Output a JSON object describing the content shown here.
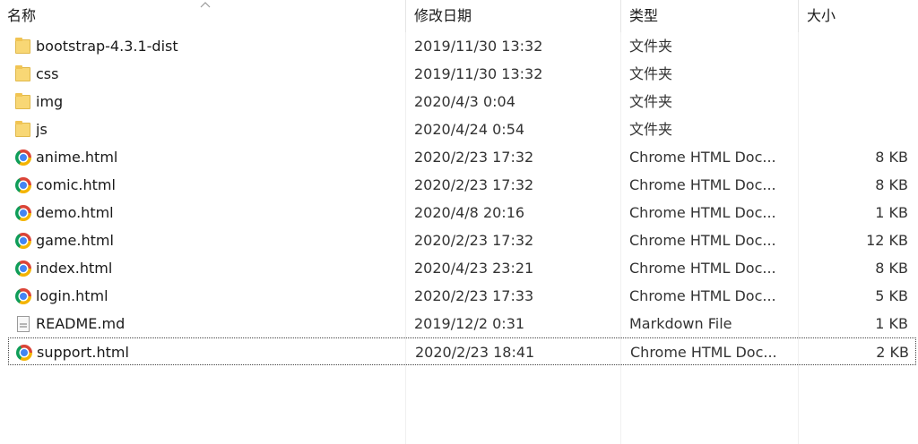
{
  "header": {
    "name": "名称",
    "date": "修改日期",
    "type": "类型",
    "size": "大小"
  },
  "files": [
    {
      "name": "bootstrap-4.3.1-dist",
      "date": "2019/11/30 13:32",
      "type": "文件夹",
      "size": "",
      "icon": "folder-icon"
    },
    {
      "name": "css",
      "date": "2019/11/30 13:32",
      "type": "文件夹",
      "size": "",
      "icon": "folder-icon"
    },
    {
      "name": "img",
      "date": "2020/4/3 0:04",
      "type": "文件夹",
      "size": "",
      "icon": "folder-icon"
    },
    {
      "name": "js",
      "date": "2020/4/24 0:54",
      "type": "文件夹",
      "size": "",
      "icon": "folder-icon"
    },
    {
      "name": "anime.html",
      "date": "2020/2/23 17:32",
      "type": "Chrome HTML Doc...",
      "size": "8 KB",
      "icon": "chrome-icon"
    },
    {
      "name": "comic.html",
      "date": "2020/2/23 17:32",
      "type": "Chrome HTML Doc...",
      "size": "8 KB",
      "icon": "chrome-icon"
    },
    {
      "name": "demo.html",
      "date": "2020/4/8 20:16",
      "type": "Chrome HTML Doc...",
      "size": "1 KB",
      "icon": "chrome-icon"
    },
    {
      "name": "game.html",
      "date": "2020/2/23 17:32",
      "type": "Chrome HTML Doc...",
      "size": "12 KB",
      "icon": "chrome-icon"
    },
    {
      "name": "index.html",
      "date": "2020/4/23 23:21",
      "type": "Chrome HTML Doc...",
      "size": "8 KB",
      "icon": "chrome-icon"
    },
    {
      "name": "login.html",
      "date": "2020/2/23 17:33",
      "type": "Chrome HTML Doc...",
      "size": "5 KB",
      "icon": "chrome-icon"
    },
    {
      "name": "README.md",
      "date": "2019/12/2 0:31",
      "type": "Markdown File",
      "size": "1 KB",
      "icon": "markdown-file-icon"
    },
    {
      "name": "support.html",
      "date": "2020/2/23 18:41",
      "type": "Chrome HTML Doc...",
      "size": "2 KB",
      "icon": "chrome-icon",
      "focused": true
    }
  ]
}
